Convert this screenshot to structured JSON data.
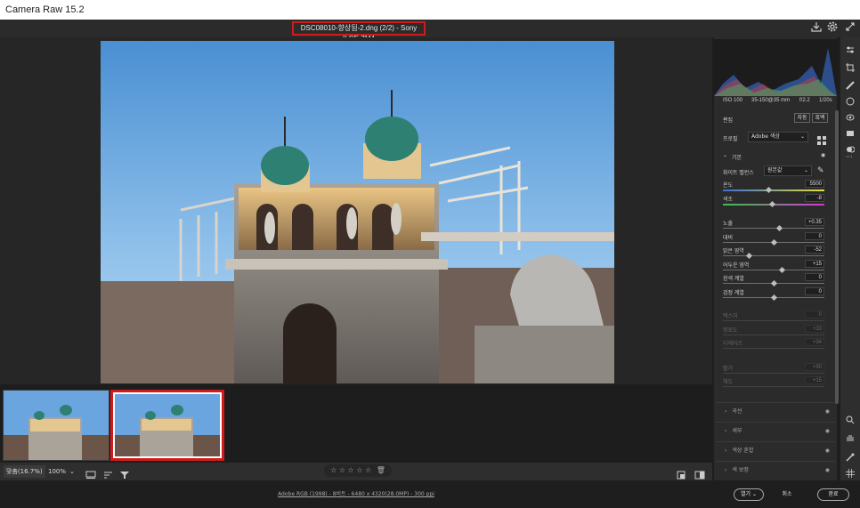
{
  "window": {
    "title": "Camera Raw 15.2"
  },
  "header": {
    "file_info": "DSC08010-향상됨-2.dng (2/2)  -  Sony ILCE-7M4"
  },
  "histogram": {
    "iso": "ISO 100",
    "lens": "35-150@35 mm",
    "aperture": "f/2.2",
    "shutter": "1/20s"
  },
  "edit": {
    "title": "편집",
    "auto_label": "자동",
    "bw_label": "흑백"
  },
  "profile": {
    "label": "프로필",
    "value": "Adobe 색상"
  },
  "basic": {
    "title": "기본",
    "wb_label": "화이트 밸런스",
    "wb_value": "원본값",
    "sliders": [
      {
        "label": "온도",
        "value": "5500",
        "pos": 0.45
      },
      {
        "label": "색조",
        "value": "-8",
        "pos": 0.48
      },
      {
        "label": "노출",
        "value": "+0.35",
        "pos": 0.55
      },
      {
        "label": "대비",
        "value": "0",
        "pos": 0.5
      },
      {
        "label": "밝은 영역",
        "value": "-52",
        "pos": 0.25
      },
      {
        "label": "어두운 영역",
        "value": "+15",
        "pos": 0.58
      },
      {
        "label": "흰색 계열",
        "value": "0",
        "pos": 0.5
      },
      {
        "label": "검정 계열",
        "value": "0",
        "pos": 0.5
      }
    ],
    "dim_sliders": [
      {
        "label": "텍스처",
        "value": "0"
      },
      {
        "label": "명료도",
        "value": "+33"
      },
      {
        "label": "디헤이즈",
        "value": "+34"
      },
      {
        "label": "활기",
        "value": "+30"
      },
      {
        "label": "채도",
        "value": "+15"
      }
    ]
  },
  "sections": [
    "곡선",
    "세부",
    "색상 혼합",
    "색 보정"
  ],
  "bottom": {
    "zoom_fit": "맞춤(16.7%)",
    "zoom": "100%",
    "stars": "☆ ☆ ☆ ☆ ☆"
  },
  "status": {
    "info": "Adobe RGB (1998) - 8비트 - 6480 x 4320(28.0MP) - 300 ppi"
  },
  "buttons": {
    "open": "열기",
    "cancel": "취소",
    "done": "완료"
  }
}
